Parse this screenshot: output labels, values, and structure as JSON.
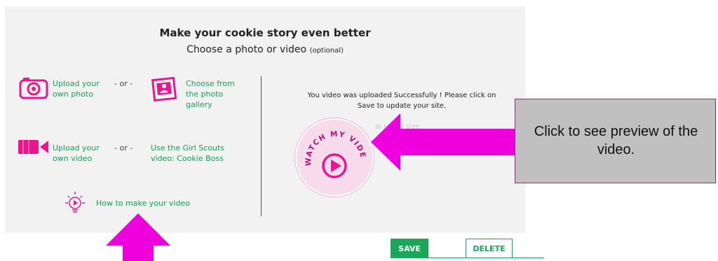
{
  "header": {
    "title": "Make your cookie story even better",
    "subtitle": "Choose a photo or video",
    "subtitle_optional": "(optional)"
  },
  "options": {
    "upload_photo": "Upload your own photo",
    "or1": "- or -",
    "choose_gallery": "Choose from the photo gallery",
    "upload_video": "Upload your own video",
    "or2": "- or -",
    "gs_video": "Use the Girl Scouts video: Cookie Boss",
    "how_to": "How to make your video"
  },
  "status": {
    "line1": "You video was uploaded Successfully ! Please click on",
    "line2": "Save to update your site.",
    "faint": "al photo size"
  },
  "watch_badge": "WATCH MY VIDEO",
  "callout": "Click to see preview of the video.",
  "actions": {
    "save": "SAVE",
    "delete": "DELETE"
  },
  "colors": {
    "accent_pink": "#e9178f",
    "green": "#14a05a",
    "arrow": "#ee00dd",
    "callout_bg": "#c0c0c0"
  },
  "icons": [
    "camera-icon",
    "gallery-icon",
    "video-camera-icon",
    "lightbulb-icon",
    "play-icon"
  ]
}
